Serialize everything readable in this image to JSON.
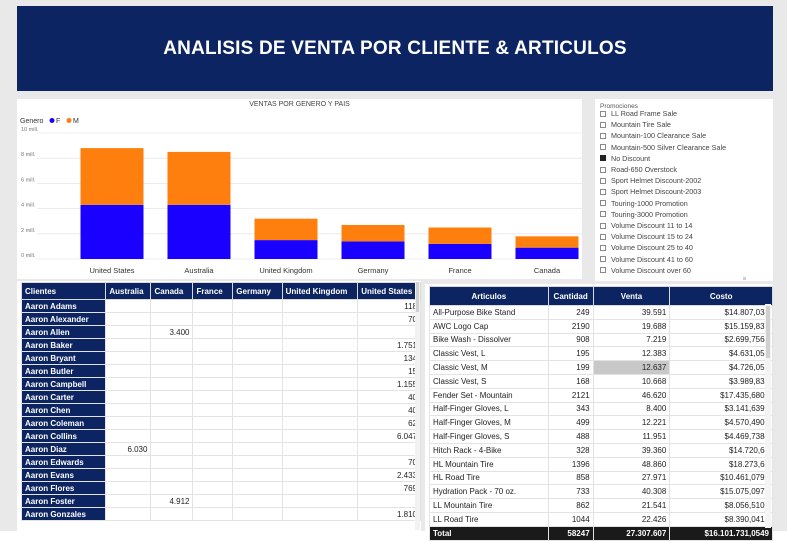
{
  "banner": {
    "title": "ANALISIS DE VENTA POR CLIENTE & ARTICULOS"
  },
  "chart_data": {
    "type": "bar",
    "title": "VENTAS POR GENERO Y PAIS",
    "legend_title": "Genero",
    "legend_position": "top-left",
    "categories": [
      "United States",
      "Australia",
      "United Kingdom",
      "Germany",
      "France",
      "Canada"
    ],
    "series": [
      {
        "name": "F",
        "color": "#1a00ff",
        "values": [
          4.3,
          4.3,
          1.5,
          1.4,
          1.2,
          0.9
        ]
      },
      {
        "name": "M",
        "color": "#ff7f0e",
        "values": [
          4.5,
          4.2,
          1.7,
          1.3,
          1.3,
          0.9
        ]
      }
    ],
    "stacked": true,
    "ylim": [
      0,
      10
    ],
    "yticks": [
      "0 mill.",
      "2 mill.",
      "4 mill.",
      "6 mill.",
      "8 mill.",
      "10 mill."
    ],
    "grid": true
  },
  "slicer": {
    "title": "Promociones",
    "items": [
      {
        "label": "LL Road Frame Sale",
        "checked": false
      },
      {
        "label": "Mountain Tire Sale",
        "checked": false
      },
      {
        "label": "Mountain-100 Clearance Sale",
        "checked": false
      },
      {
        "label": "Mountain-500 Silver Clearance Sale",
        "checked": false
      },
      {
        "label": "No Discount",
        "checked": true
      },
      {
        "label": "Road-650 Overstock",
        "checked": false
      },
      {
        "label": "Sport Helmet Discount-2002",
        "checked": false
      },
      {
        "label": "Sport Helmet Discount-2003",
        "checked": false
      },
      {
        "label": "Touring-1000 Promotion",
        "checked": false
      },
      {
        "label": "Touring-3000 Promotion",
        "checked": false
      },
      {
        "label": "Volume Discount 11 to 14",
        "checked": false
      },
      {
        "label": "Volume Discount 15 to 24",
        "checked": false
      },
      {
        "label": "Volume Discount 25 to 40",
        "checked": false
      },
      {
        "label": "Volume Discount 41 to 60",
        "checked": false
      },
      {
        "label": "Volume Discount over 60",
        "checked": false
      }
    ]
  },
  "customers": {
    "headers": [
      "Clientes",
      "Australia",
      "Canada",
      "France",
      "Germany",
      "United Kingdom",
      "United States"
    ],
    "rows": [
      [
        "Aaron Adams",
        "",
        "",
        "",
        "",
        "",
        "118"
      ],
      [
        "Aaron Alexander",
        "",
        "",
        "",
        "",
        "",
        "70"
      ],
      [
        "Aaron Allen",
        "",
        "3.400",
        "",
        "",
        "",
        ""
      ],
      [
        "Aaron Baker",
        "",
        "",
        "",
        "",
        "",
        "1.751"
      ],
      [
        "Aaron Bryant",
        "",
        "",
        "",
        "",
        "",
        "134"
      ],
      [
        "Aaron Butler",
        "",
        "",
        "",
        "",
        "",
        "15"
      ],
      [
        "Aaron Campbell",
        "",
        "",
        "",
        "",
        "",
        "1.155"
      ],
      [
        "Aaron Carter",
        "",
        "",
        "",
        "",
        "",
        "40"
      ],
      [
        "Aaron Chen",
        "",
        "",
        "",
        "",
        "",
        "40"
      ],
      [
        "Aaron Coleman",
        "",
        "",
        "",
        "",
        "",
        "62"
      ],
      [
        "Aaron Collins",
        "",
        "",
        "",
        "",
        "",
        "6.047"
      ],
      [
        "Aaron Diaz",
        "6.030",
        "",
        "",
        "",
        "",
        ""
      ],
      [
        "Aaron Edwards",
        "",
        "",
        "",
        "",
        "",
        "70"
      ],
      [
        "Aaron Evans",
        "",
        "",
        "",
        "",
        "",
        "2.433"
      ],
      [
        "Aaron Flores",
        "",
        "",
        "",
        "",
        "",
        "769"
      ],
      [
        "Aaron Foster",
        "",
        "4.912",
        "",
        "",
        "",
        ""
      ],
      [
        "Aaron Gonzales",
        "",
        "",
        "",
        "",
        "",
        "1.810"
      ]
    ]
  },
  "articles": {
    "headers": [
      "Articulos",
      "Cantidad",
      "Venta",
      "Costo"
    ],
    "rows": [
      [
        "All-Purpose Bike Stand",
        "249",
        "39.591",
        "$14.807,034"
      ],
      [
        "AWC Logo Cap",
        "2190",
        "19.688",
        "$15.159,837"
      ],
      [
        "Bike Wash - Dissolver",
        "908",
        "7.219",
        "$2.699,7564"
      ],
      [
        "Classic Vest, L",
        "195",
        "12.383",
        "$4.631,055"
      ],
      [
        "Classic Vest, M",
        "199",
        "12.637",
        "$4.726,051"
      ],
      [
        "Classic Vest, S",
        "168",
        "10.668",
        "$3.989,832"
      ],
      [
        "Fender Set - Mountain",
        "2121",
        "46.620",
        "$17.435,6805"
      ],
      [
        "Half-Finger Gloves, L",
        "343",
        "8.400",
        "$3.141,6399"
      ],
      [
        "Half-Finger Gloves, M",
        "499",
        "12.221",
        "$4.570,4907"
      ],
      [
        "Half-Finger Gloves, S",
        "488",
        "11.951",
        "$4.469,7384"
      ],
      [
        "Hitch Rack - 4-Bike",
        "328",
        "39.360",
        "$14.720,64"
      ],
      [
        "HL Mountain Tire",
        "1396",
        "48.860",
        "$18.273,64"
      ],
      [
        "HL Road Tire",
        "858",
        "27.971",
        "$10.461,0792"
      ],
      [
        "Hydration Pack - 70 oz.",
        "733",
        "40.308",
        "$15.075,0979"
      ],
      [
        "LL Mountain Tire",
        "862",
        "21.541",
        "$8.056,5106"
      ],
      [
        "LL Road Tire",
        "1044",
        "22.426",
        "$8.390,0412"
      ]
    ],
    "total": [
      "Total",
      "58247",
      "27.307.607",
      "$16.101.731,0549"
    ]
  }
}
